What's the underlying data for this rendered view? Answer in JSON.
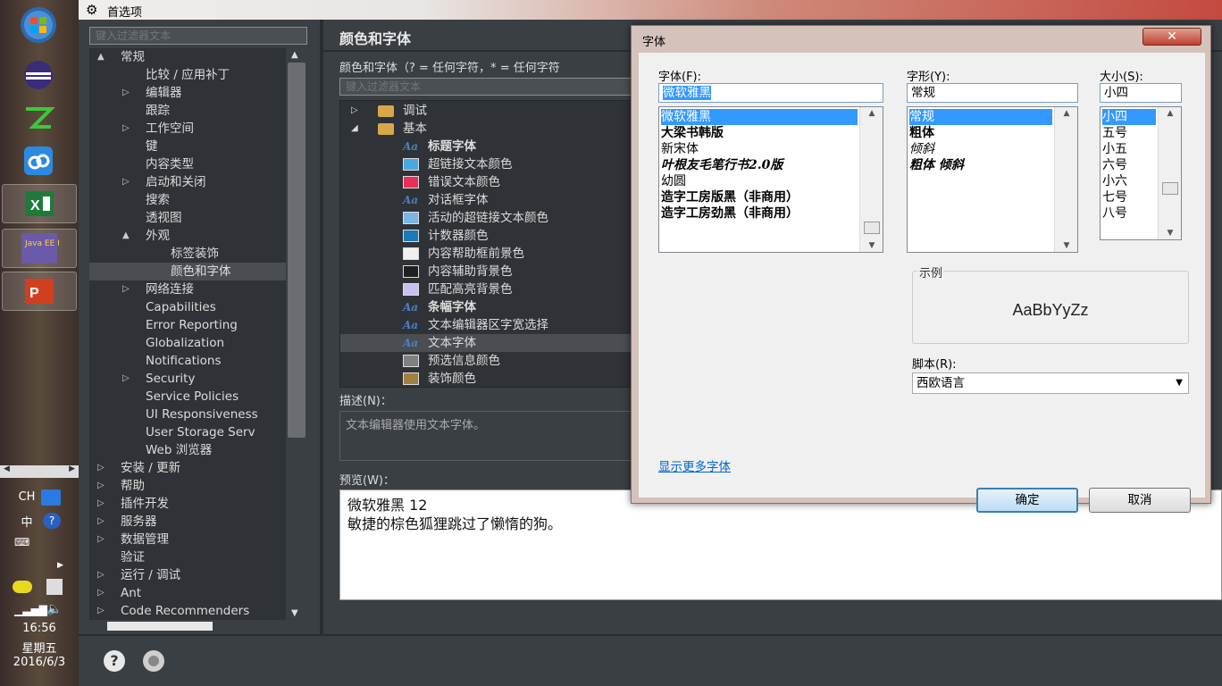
{
  "window": {
    "title": "首选项",
    "filter_placeholder": "键入过滤器文本"
  },
  "tree": {
    "items": [
      {
        "label": "常规",
        "level": 0,
        "arrow": "▲"
      },
      {
        "label": "比较 / 应用补丁",
        "level": 1,
        "arrow": ""
      },
      {
        "label": "编辑器",
        "level": 1,
        "arrow": "▷"
      },
      {
        "label": "跟踪",
        "level": 1,
        "arrow": ""
      },
      {
        "label": "工作空间",
        "level": 1,
        "arrow": "▷"
      },
      {
        "label": "键",
        "level": 1,
        "arrow": ""
      },
      {
        "label": "内容类型",
        "level": 1,
        "arrow": ""
      },
      {
        "label": "启动和关闭",
        "level": 1,
        "arrow": "▷"
      },
      {
        "label": "搜索",
        "level": 1,
        "arrow": ""
      },
      {
        "label": "透视图",
        "level": 1,
        "arrow": ""
      },
      {
        "label": "外观",
        "level": 1,
        "arrow": "▲"
      },
      {
        "label": "标签装饰",
        "level": 2,
        "arrow": ""
      },
      {
        "label": "颜色和字体",
        "level": 2,
        "arrow": "",
        "selected": true
      },
      {
        "label": "网络连接",
        "level": 1,
        "arrow": "▷"
      },
      {
        "label": "Capabilities",
        "level": 1,
        "arrow": ""
      },
      {
        "label": "Error Reporting",
        "level": 1,
        "arrow": ""
      },
      {
        "label": "Globalization",
        "level": 1,
        "arrow": ""
      },
      {
        "label": "Notifications",
        "level": 1,
        "arrow": ""
      },
      {
        "label": "Security",
        "level": 1,
        "arrow": "▷"
      },
      {
        "label": "Service Policies",
        "level": 1,
        "arrow": ""
      },
      {
        "label": "UI Responsiveness",
        "level": 1,
        "arrow": ""
      },
      {
        "label": "User Storage Serv",
        "level": 1,
        "arrow": ""
      },
      {
        "label": "Web 浏览器",
        "level": 1,
        "arrow": ""
      },
      {
        "label": "安装 / 更新",
        "level": 0,
        "arrow": "▷"
      },
      {
        "label": "帮助",
        "level": 0,
        "arrow": "▷"
      },
      {
        "label": "插件开发",
        "level": 0,
        "arrow": "▷"
      },
      {
        "label": "服务器",
        "level": 0,
        "arrow": "▷"
      },
      {
        "label": "数据管理",
        "level": 0,
        "arrow": "▷"
      },
      {
        "label": "验证",
        "level": 0,
        "arrow": ""
      },
      {
        "label": "运行 / 调试",
        "level": 0,
        "arrow": "▷"
      },
      {
        "label": "Ant",
        "level": 0,
        "arrow": "▷"
      },
      {
        "label": "Code Recommenders",
        "level": 0,
        "arrow": "▷"
      }
    ]
  },
  "colors_fonts": {
    "title": "颜色和字体",
    "description": "颜色和字体（? = 任何字符，* = 任何字符",
    "filter_placeholder": "键入过滤器文本",
    "items": [
      {
        "label": "调试",
        "kind": "folder",
        "arrow": "▷",
        "indent": 0
      },
      {
        "label": "基本",
        "kind": "folder",
        "arrow": "◢",
        "indent": 0
      },
      {
        "label": "标题字体",
        "kind": "font",
        "bold": true,
        "indent": 1
      },
      {
        "label": "超链接文本颜色",
        "kind": "color",
        "color": "#4aa8e0",
        "indent": 1
      },
      {
        "label": "错误文本颜色",
        "kind": "color",
        "color": "#e8305a",
        "indent": 1
      },
      {
        "label": "对话框字体",
        "kind": "font",
        "indent": 1
      },
      {
        "label": "活动的超链接文本颜色",
        "kind": "color",
        "color": "#7ab4e8",
        "indent": 1
      },
      {
        "label": "计数器颜色",
        "kind": "color",
        "color": "#1a7ab8",
        "indent": 1
      },
      {
        "label": "内容帮助框前景色",
        "kind": "color",
        "color": "#f0f0f0",
        "indent": 1
      },
      {
        "label": "内容辅助背景色",
        "kind": "color",
        "color": "#202020",
        "indent": 1
      },
      {
        "label": "匹配高亮背景色",
        "kind": "color",
        "color": "#c8c0f0",
        "indent": 1
      },
      {
        "label": "条幅字体",
        "kind": "font",
        "bold": true,
        "indent": 1
      },
      {
        "label": "文本编辑器区字宽选择",
        "kind": "font",
        "indent": 1
      },
      {
        "label": "文本字体",
        "kind": "font",
        "indent": 1,
        "selected": true
      },
      {
        "label": "预选信息颜色",
        "kind": "color",
        "color": "#808080",
        "indent": 1
      },
      {
        "label": "装饰颜色",
        "kind": "color",
        "color": "#a08040",
        "indent": 1
      }
    ],
    "desc_label": "描述(N)：",
    "desc_text": "文本编辑器使用文本字体。",
    "preview_label": "预览(W)：",
    "preview_line1": "微软雅黑 12",
    "preview_line2": "敏捷的棕色狐狸跳过了懒惰的狗。"
  },
  "font_dialog": {
    "title": "字体",
    "close": "✕",
    "font_label": "字体(F):",
    "font_value": "微软雅黑",
    "font_list": [
      "微软雅黑",
      "大梁书韩版",
      "新宋体",
      "叶根友毛笔行书2.0版",
      "幼圆",
      "造字工房版黑（非商用）",
      "造字工房劲黑（非商用）"
    ],
    "style_label": "字形(Y):",
    "style_value": "常规",
    "style_list": [
      "常规",
      "粗体",
      "倾斜",
      "粗体 倾斜"
    ],
    "size_label": "大小(S):",
    "size_value": "小四",
    "size_list": [
      "小四",
      "五号",
      "小五",
      "六号",
      "小六",
      "七号",
      "八号"
    ],
    "sample_label": "示例",
    "sample_text": "AaBbYyZz",
    "script_label": "脚本(R):",
    "script_value": "西欧语言",
    "more_fonts": "显示更多字体",
    "ok": "确定",
    "cancel": "取消"
  },
  "taskbar": {
    "ime1": "CH",
    "ime2": "中",
    "time": "16:56",
    "weekday": "星期五",
    "date": "2016/6/3",
    "java_label": "Java EE IDE"
  }
}
